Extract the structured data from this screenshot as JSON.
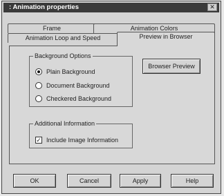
{
  "window": {
    "title": ": Animation properties",
    "close_glyph": "✕"
  },
  "tabs": {
    "row_back": [
      "Frame",
      "Animation Colors"
    ],
    "row_front": [
      "Animation Loop and Speed",
      "Preview in Browser"
    ],
    "active": "Preview in Browser"
  },
  "background_options": {
    "legend": "Background Options",
    "items": [
      {
        "label": "Plain Background",
        "selected": true
      },
      {
        "label": "Document Background",
        "selected": false
      },
      {
        "label": "Checkered Background",
        "selected": false
      }
    ]
  },
  "additional_information": {
    "legend": "Additional Information",
    "checkbox_label": "Include Image Information",
    "checked": true
  },
  "browser_preview_button": "Browser Preview",
  "footer": {
    "ok": "OK",
    "cancel": "Cancel",
    "apply": "Apply",
    "help": "Help"
  }
}
